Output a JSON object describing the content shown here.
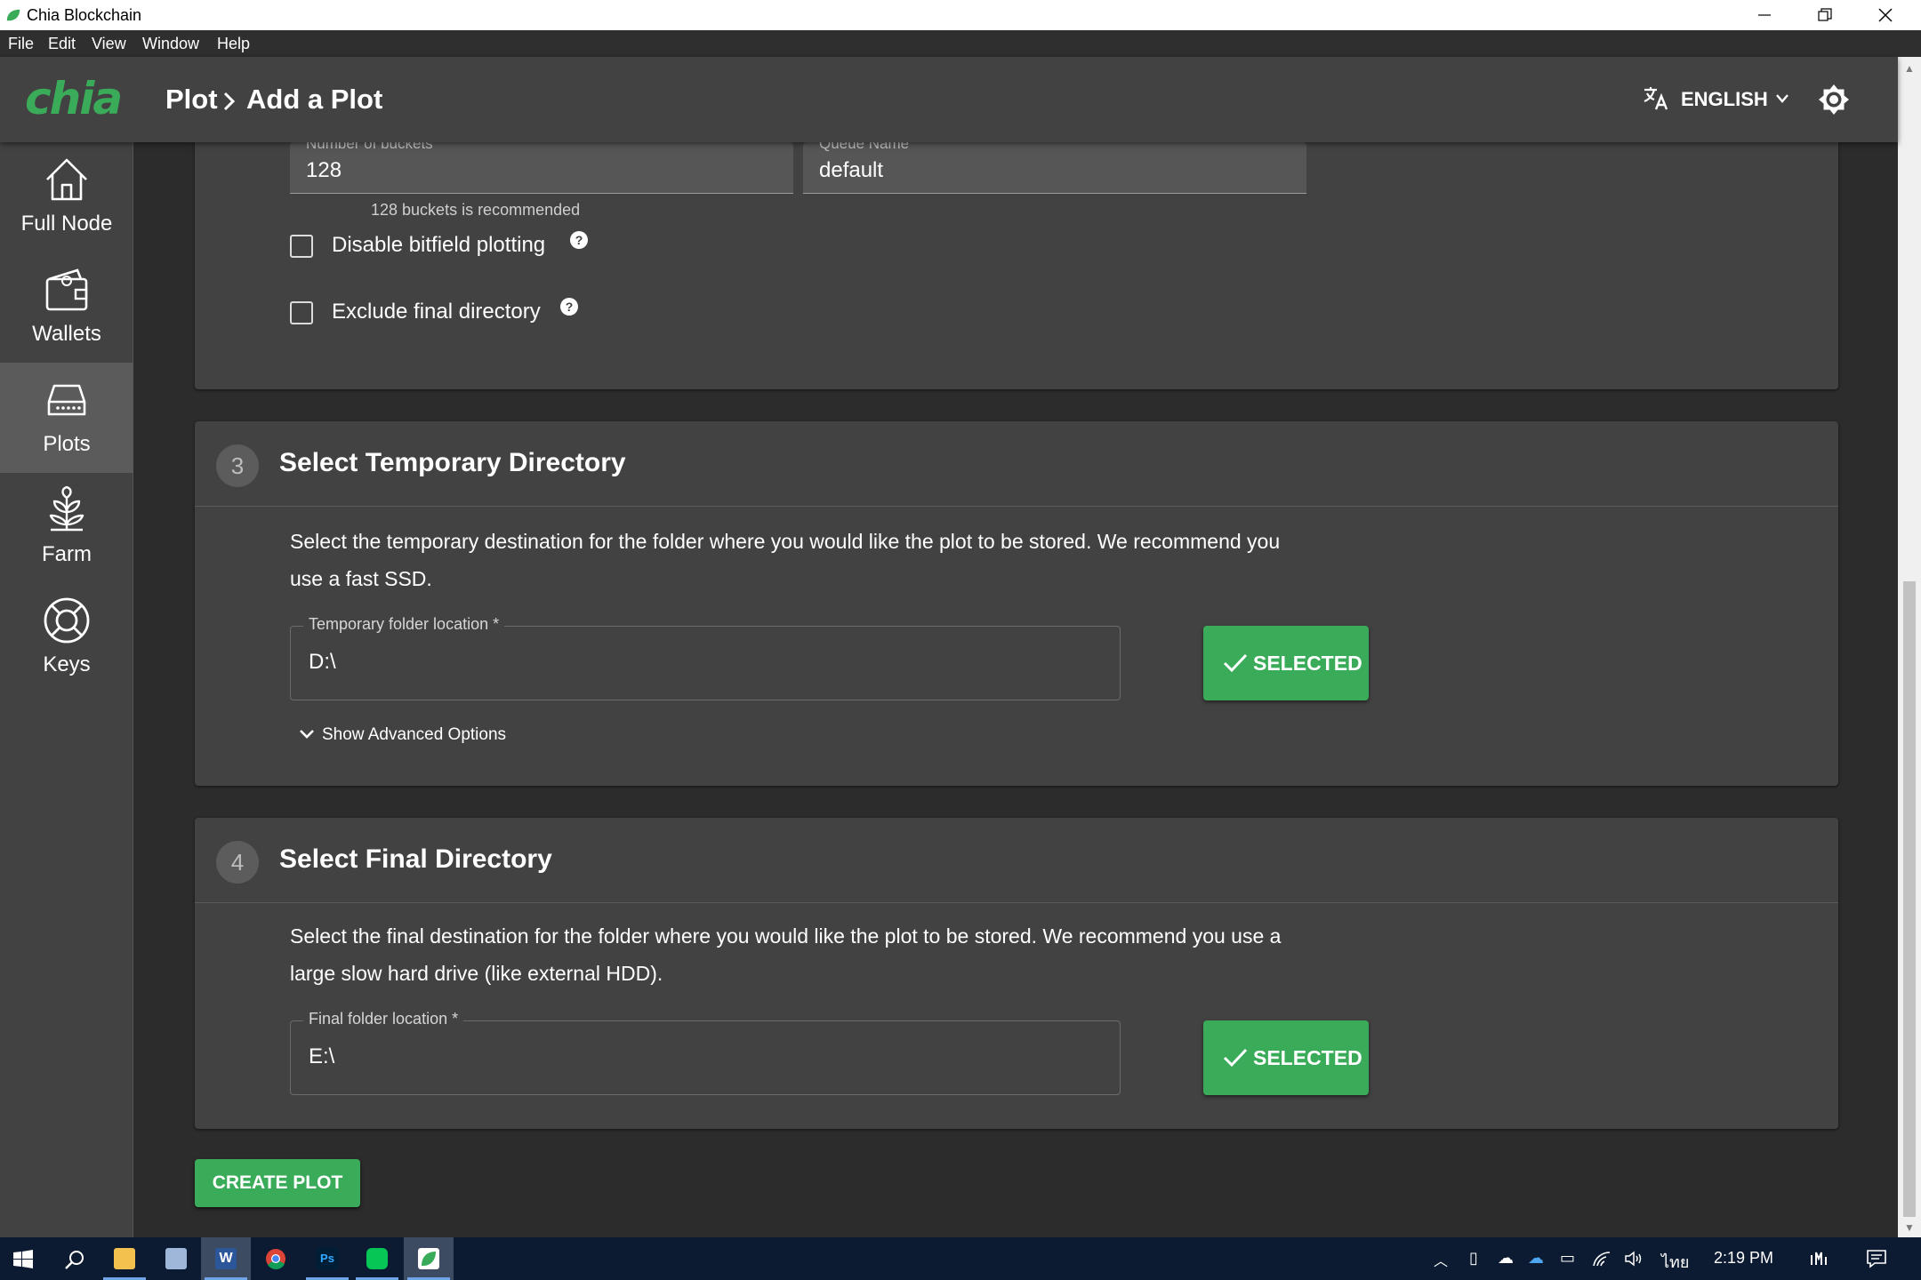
{
  "window": {
    "title": "Chia Blockchain",
    "menu": [
      "File",
      "Edit",
      "View",
      "Window",
      "Help"
    ]
  },
  "header": {
    "logo": "chia",
    "breadcrumb_root": "Plot",
    "breadcrumb_separator": ">",
    "breadcrumb_current": "Add a Plot",
    "language": "ENGLISH"
  },
  "sidebar": {
    "items": [
      {
        "label": "Full Node",
        "icon": "home-icon"
      },
      {
        "label": "Wallets",
        "icon": "wallet-icon"
      },
      {
        "label": "Plots",
        "icon": "hard-drive-icon",
        "active": true
      },
      {
        "label": "Farm",
        "icon": "plant-icon"
      },
      {
        "label": "Keys",
        "icon": "lifebuoy-icon"
      }
    ]
  },
  "advanced_card": {
    "buckets_label": "Number of buckets",
    "buckets_value": "128",
    "buckets_helper": "128 buckets is recommended",
    "queue_label": "Queue Name",
    "queue_value": "default",
    "disable_bitfield_label": "Disable bitfield plotting",
    "exclude_final_label": "Exclude final directory"
  },
  "temp_card": {
    "step": "3",
    "title": "Select Temporary Directory",
    "description": "Select the temporary destination for the folder where you would like the plot to be stored. We recommend you use a fast SSD.",
    "field_label": "Temporary folder location *",
    "field_value": "D:\\",
    "button_label": "SELECTED",
    "advanced_toggle": "Show Advanced Options"
  },
  "final_card": {
    "step": "4",
    "title": "Select Final Directory",
    "description": "Select the final destination for the folder where you would like the plot to be stored. We recommend you use a large slow hard drive (like external HDD).",
    "field_label": "Final folder location *",
    "field_value": "E:\\",
    "button_label": "SELECTED"
  },
  "create_button": "CREATE PLOT",
  "taskbar": {
    "time": "2:19 PM",
    "language": "ไทย"
  },
  "colors": {
    "accent": "#3aac59",
    "surface": "#424242",
    "background": "#2c2c2c"
  }
}
